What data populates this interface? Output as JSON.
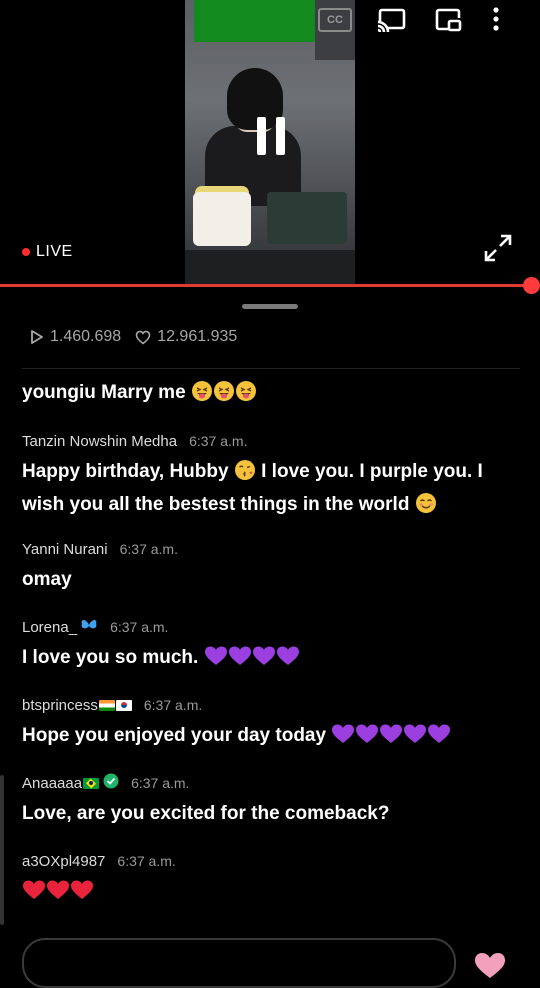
{
  "player": {
    "cc_label": "CC",
    "live_label": "LIVE",
    "colors": {
      "accent": "#e53935",
      "live_dot": "#ff2d2d"
    },
    "icons": [
      "cast-icon",
      "picture-in-picture-icon",
      "more-vert-icon",
      "pause-icon",
      "fullscreen-icon"
    ]
  },
  "stats": {
    "views": "1.460.698",
    "likes": "12.961.935"
  },
  "chat": {
    "messages": [
      {
        "author": "",
        "time": "",
        "text": "youngiu Marry me",
        "emojis": 3
      },
      {
        "author": "Tanzin Nowshin Medha",
        "time": "6:37 a.m.",
        "text": "Happy birthday, Hubby",
        "text2": "I love you. I purple you. I wish you all the bestest things in the world"
      },
      {
        "author": "Yanni Nurani",
        "time": "6:37 a.m.",
        "text": "omay"
      },
      {
        "author": "Lorena_",
        "time": "6:37 a.m.",
        "text": "I love you so much."
      },
      {
        "author": "btsprincess",
        "time": "6:37 a.m.",
        "text": "Hope you enjoyed your day today"
      },
      {
        "author": "Anaaaaa",
        "time": "6:37 a.m.",
        "text": "Love, are you excited for the comeback?"
      },
      {
        "author": "a3OXpl4987",
        "time": "6:37 a.m.",
        "text": ""
      }
    ]
  }
}
